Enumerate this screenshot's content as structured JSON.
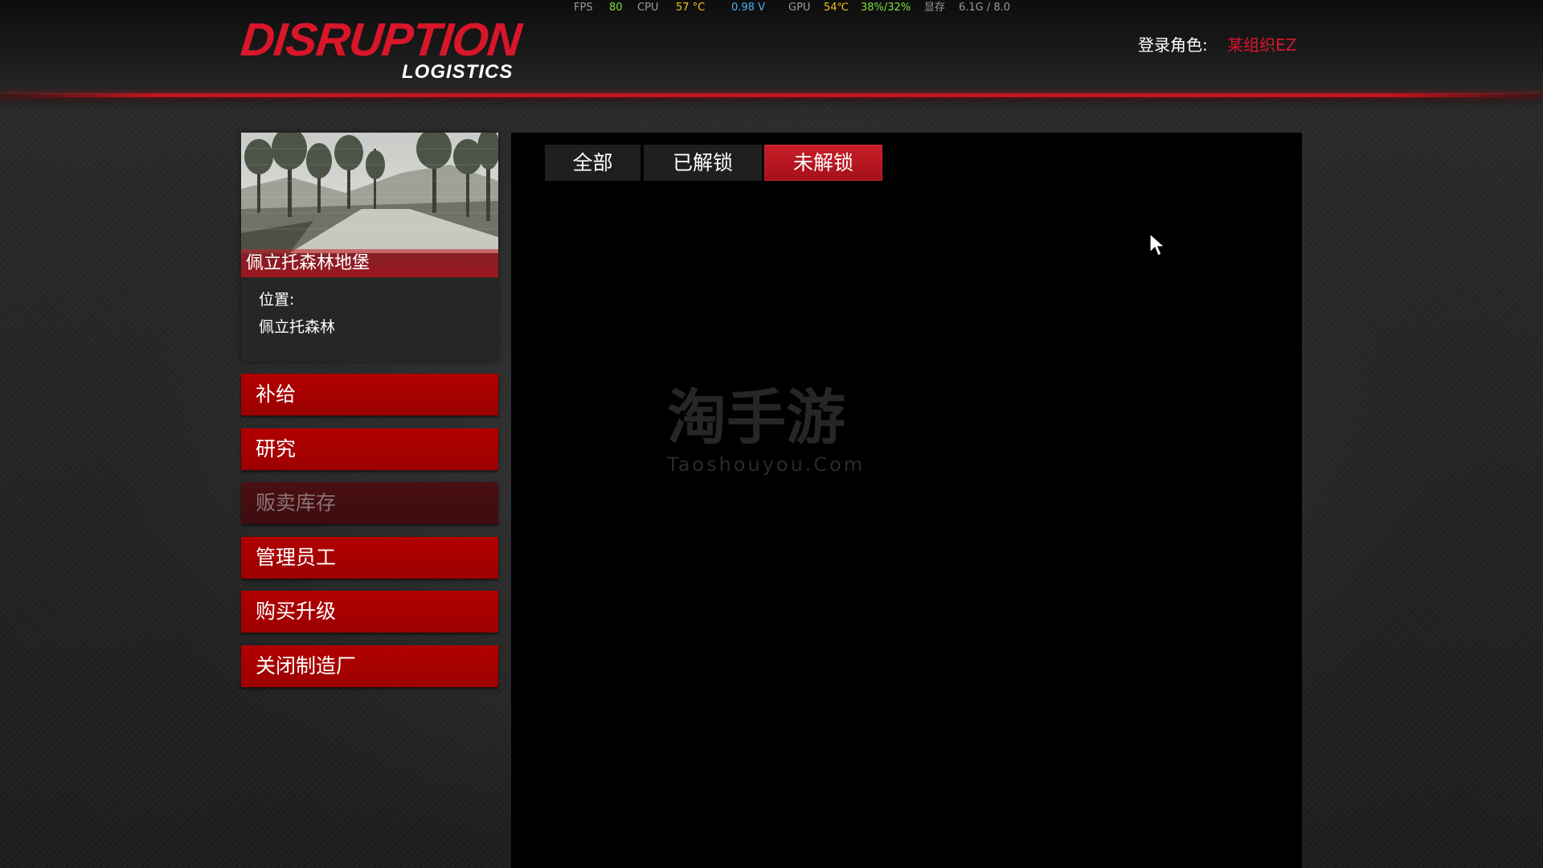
{
  "overlay": {
    "fps_label": "FPS",
    "fps_value": "80",
    "cpu_label": "CPU",
    "cpu_temp": "57 °C",
    "cpu_voltage": "0.98 V",
    "gpu_label": "GPU",
    "gpu_temp": "54℃",
    "gpu_usage": "38%/32%",
    "vram_label": "显存",
    "vram_value": "6.1G / 8.0",
    "colors": {
      "label": "#9a9a9a",
      "green": "#7ee23a",
      "yellow": "#f0c419",
      "blue": "#4ab3f4"
    }
  },
  "header": {
    "logo_main": "DISRUPTION",
    "logo_sub": "LOGISTICS",
    "login_label": "登录角色:",
    "login_role": "某组织EZ"
  },
  "property": {
    "name": "佩立托森林地堡",
    "location_label": "位置:",
    "location_value": "佩立托森林"
  },
  "menu": {
    "items": [
      {
        "label": "补给",
        "enabled": true
      },
      {
        "label": "研究",
        "enabled": true
      },
      {
        "label": "贩卖库存",
        "enabled": false
      },
      {
        "label": "管理员工",
        "enabled": true
      },
      {
        "label": "购买升级",
        "enabled": true
      },
      {
        "label": "关闭制造厂",
        "enabled": true
      }
    ]
  },
  "tabs": {
    "items": [
      {
        "label": "全部",
        "active": false
      },
      {
        "label": "已解锁",
        "active": false
      },
      {
        "label": "未解锁",
        "active": true
      }
    ]
  },
  "watermark": {
    "cn": "淘手游",
    "en": "Taoshouyou.Com"
  },
  "colors": {
    "accent_red": "#d8162a",
    "button_red": "#a80000",
    "panel_black": "#000000"
  }
}
